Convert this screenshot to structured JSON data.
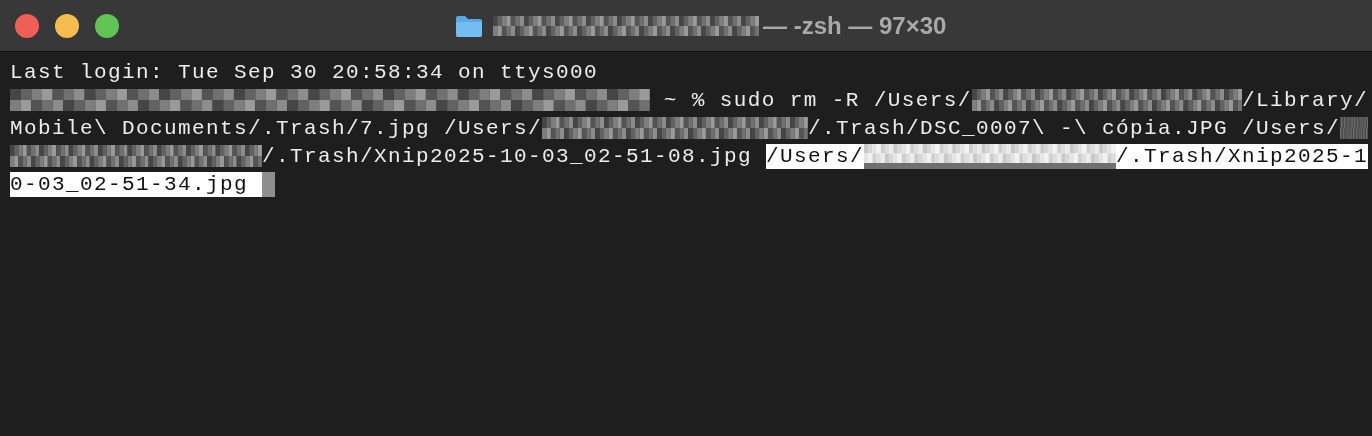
{
  "window": {
    "title_redacted": true,
    "title": "— -zsh — 97×30"
  },
  "terminal": {
    "lines": [
      {
        "segments": [
          {
            "kind": "text",
            "text": "Last login: Tue Sep 30 20:58:34 on ttys000",
            "selected": false
          }
        ]
      },
      {
        "segments": [
          {
            "kind": "longredacted",
            "selected": false
          },
          {
            "kind": "text",
            "text": " ~ % sudo rm -R /Users/",
            "selected": false
          },
          {
            "kind": "redacted",
            "selected": false
          },
          {
            "kind": "text",
            "text": "/Library/",
            "selected": false
          }
        ]
      },
      {
        "segments": [
          {
            "kind": "text",
            "text": "Mobile\\ Documents/.Trash/7.jpg /Users/",
            "selected": false
          },
          {
            "kind": "redacted",
            "selected": false
          },
          {
            "kind": "text",
            "text": "/.Trash/DSC_0007\\ -\\ cópia.JPG /Users/",
            "selected": false
          },
          {
            "kind": "shortredacted",
            "selected": false
          }
        ]
      },
      {
        "segments": [
          {
            "kind": "redacted",
            "selected": false
          },
          {
            "kind": "text",
            "text": "/.Trash/Xnip2025-10-03_02-51-08.jpg ",
            "selected": false
          },
          {
            "kind": "text",
            "text": "/Users/",
            "selected": true
          },
          {
            "kind": "redacted",
            "selected": true
          },
          {
            "kind": "text",
            "text": "/.Trash/Xnip2025-1",
            "selected": true
          }
        ]
      },
      {
        "segments": [
          {
            "kind": "text",
            "text": "0-03_02-51-34.jpg ",
            "selected": true
          },
          {
            "kind": "cursor"
          }
        ]
      }
    ]
  }
}
